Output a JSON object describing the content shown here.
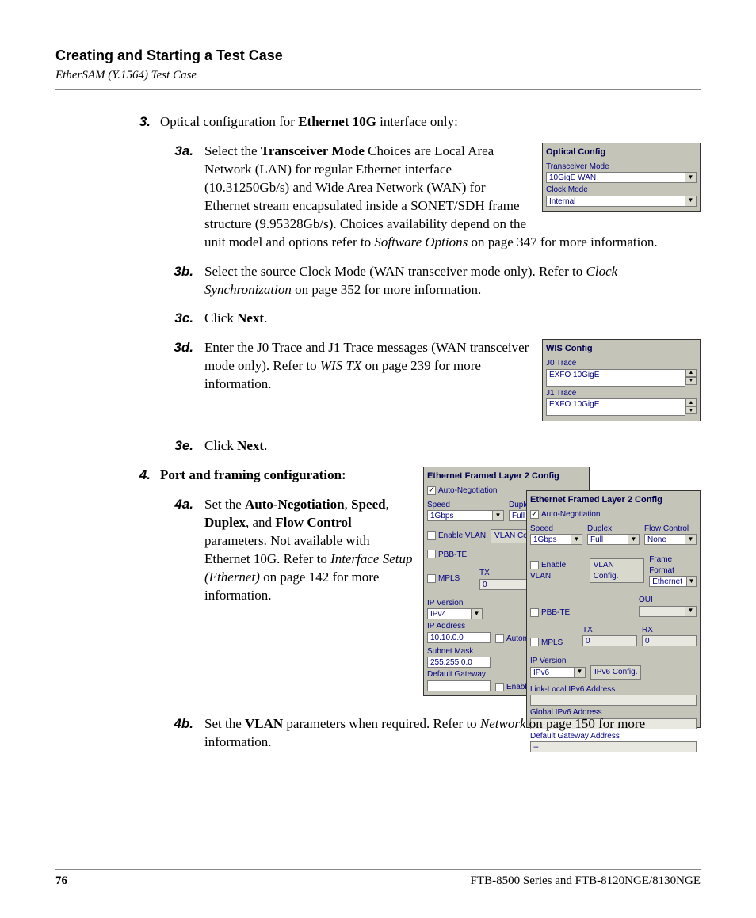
{
  "header": {
    "title": "Creating and Starting a Test Case",
    "subtitle": "EtherSAM (Y.1564) Test Case"
  },
  "step3": {
    "num": "3.",
    "intro": {
      "pre": "Optical configuration for ",
      "bold": "Ethernet 10G",
      "post": " interface only:"
    },
    "a": {
      "num": "3a.",
      "t1": "Select the ",
      "b1": "Transceiver Mode",
      "t2": " Choices are Local Area Network (LAN) for regular Ethernet interface (10.31250Gb/s) and Wide Area Network (WAN) for Ethernet stream encapsulated inside a SONET/SDH frame structure (9.95328Gb/s). Choices availability depend on the unit model and options refer to ",
      "i1": "Software Options",
      "t3": " on page 347 for more information."
    },
    "b": {
      "num": "3b.",
      "t1": "Select the source Clock Mode (WAN transceiver mode only). Refer to ",
      "i1": "Clock Synchronization",
      "t2": " on page 352 for more information."
    },
    "c": {
      "num": "3c.",
      "t1": "Click ",
      "b1": "Next",
      "t2": "."
    },
    "d": {
      "num": "3d.",
      "t1": "Enter the J0 Trace and J1 Trace messages (WAN transceiver mode only). Refer to ",
      "i1": "WIS TX",
      "t2": " on page 239 for more information."
    },
    "e": {
      "num": "3e.",
      "t1": "Click ",
      "b1": "Next",
      "t2": "."
    }
  },
  "step4": {
    "num": "4.",
    "heading": "Port and framing configuration:",
    "a": {
      "num": "4a.",
      "t1": "Set the ",
      "b1": "Auto-Negotiation",
      "sep1": ", ",
      "b2": "Speed",
      "sep2": ", ",
      "b3": "Duplex",
      "sep3": ", and ",
      "b4": "Flow Control",
      "t2": " parameters. Not available with Ethernet 10G. Refer to ",
      "i1": "Interface Setup (Ethernet)",
      "t3": " on page 142 for more information."
    },
    "b": {
      "num": "4b.",
      "t1": "Set the ",
      "b1": "VLAN",
      "t2": " parameters when required. Refer to ",
      "i1": "Network",
      "t3": " on page 150 for more information."
    }
  },
  "optical": {
    "title": "Optical Config",
    "lbl_trans": "Transceiver Mode",
    "val_trans": "10GigE WAN",
    "lbl_clock": "Clock Mode",
    "val_clock": "Internal"
  },
  "wis": {
    "title": "WIS Config",
    "lbl_j0": "J0 Trace",
    "val_j0": "EXFO 10GigE",
    "lbl_j1": "J1 Trace",
    "val_j1": "EXFO 10GigE"
  },
  "l2back": {
    "title": "Ethernet Framed Layer 2 Config",
    "autoneg_lbl": "Auto-Negotiation",
    "speed_lbl": "Speed",
    "speed_val": "1Gbps",
    "duplex_lbl": "Duplex",
    "duplex_val": "Full",
    "enable_vlan": "Enable VLAN",
    "vlan_btn": "VLAN Config.",
    "pbbte": "PBB-TE",
    "mpls": "MPLS",
    "tx": "TX",
    "tx_val": "0",
    "ipver_lbl": "IP Version",
    "ipver_val": "IPv4",
    "ipaddr_lbl": "IP Address",
    "ipaddr_val": "10.10.0.0",
    "autoip": "Automatic IP",
    "subnet_lbl": "Subnet Mask",
    "subnet_val": "255.255.0.0",
    "gw_lbl": "Default Gateway",
    "enable": "Enable"
  },
  "l2front": {
    "title": "Ethernet Framed Layer 2 Config",
    "autoneg_lbl": "Auto-Negotiation",
    "speed_lbl": "Speed",
    "speed_val": "1Gbps",
    "duplex_lbl": "Duplex",
    "duplex_val": "Full",
    "flow_lbl": "Flow Control",
    "flow_val": "None",
    "enable_vlan": "Enable VLAN",
    "vlan_btn": "VLAN Config.",
    "frame_lbl": "Frame Format",
    "frame_val": "Ethernet II",
    "pbbte": "PBB-TE",
    "oui_lbl": "OUI",
    "mpls": "MPLS",
    "tx": "TX",
    "tx_val": "0",
    "rx": "RX",
    "rx_val": "0",
    "ipver_lbl": "IP Version",
    "ipver_val": "IPv6",
    "ipv6_btn": "IPv6 Config.",
    "link_local": "Link-Local IPv6 Address",
    "global": "Global IPv6 Address",
    "gw": "Default Gateway Address",
    "dash": "--"
  },
  "footer": {
    "page": "76",
    "product": "FTB-8500 Series and FTB-8120NGE/8130NGE"
  }
}
